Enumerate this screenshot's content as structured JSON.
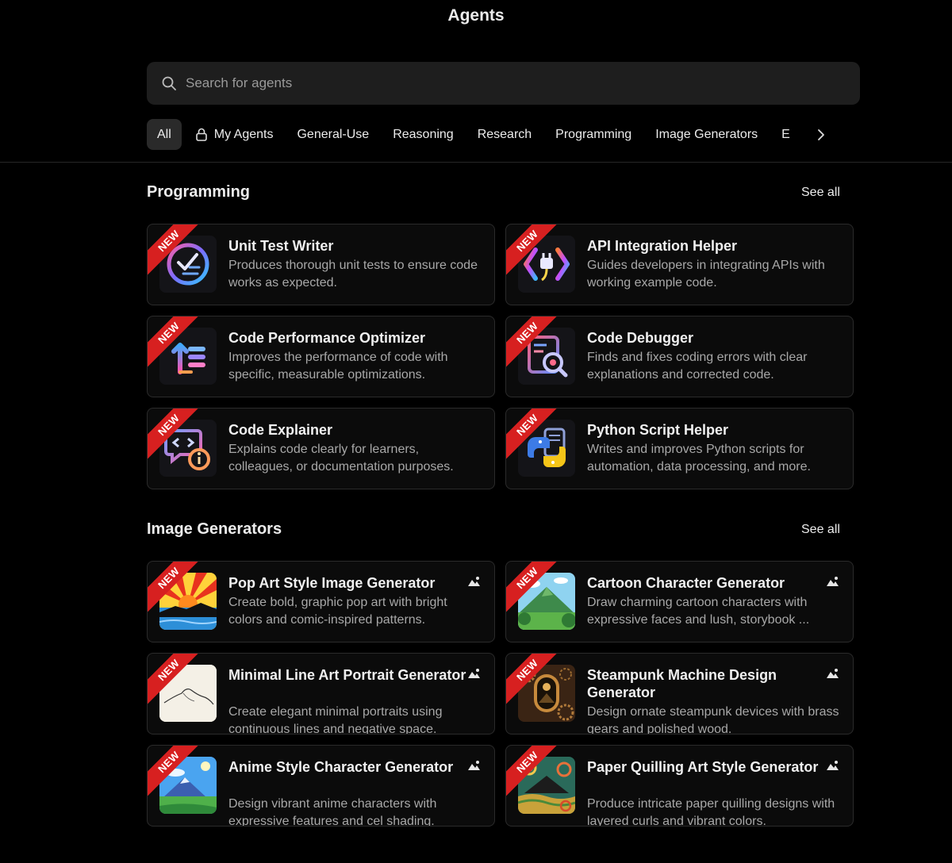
{
  "page": {
    "title": "Agents"
  },
  "search": {
    "placeholder": "Search for agents",
    "icon": "search-icon"
  },
  "tabs": [
    {
      "label": "All",
      "active": true
    },
    {
      "label": "My Agents",
      "icon": "lock-icon"
    },
    {
      "label": "General-Use"
    },
    {
      "label": "Reasoning"
    },
    {
      "label": "Research"
    },
    {
      "label": "Programming"
    },
    {
      "label": "Image Generators"
    },
    {
      "label": "E"
    }
  ],
  "sections": [
    {
      "title": "Programming",
      "see_all": "See all",
      "cards": [
        {
          "badge": "NEW",
          "name": "Unit Test Writer",
          "description": "Produces thorough unit tests to ensure code works as expected.",
          "icon": "checklist-icon"
        },
        {
          "badge": "NEW",
          "name": "API Integration Helper",
          "description": "Guides developers in integrating APIs with working example code.",
          "icon": "plug-icon"
        },
        {
          "badge": "NEW",
          "name": "Code Performance Optimizer",
          "description": "Improves the performance of code with specific, measurable optimizations.",
          "icon": "optimize-icon"
        },
        {
          "badge": "NEW",
          "name": "Code Debugger",
          "description": "Finds and fixes coding errors with clear explanations and corrected code.",
          "icon": "debug-icon"
        },
        {
          "badge": "NEW",
          "name": "Code Explainer",
          "description": "Explains code clearly for learners, colleagues, or documentation purposes.",
          "icon": "code-info-icon"
        },
        {
          "badge": "NEW",
          "name": "Python Script Helper",
          "description": "Writes and improves Python scripts for automation, data processing, and more.",
          "icon": "python-icon"
        }
      ]
    },
    {
      "title": "Image Generators",
      "see_all": "See all",
      "cards": [
        {
          "badge": "NEW",
          "name": "Pop Art Style Image Generator",
          "description": "Create bold, graphic pop art with bright colors and comic-inspired patterns.",
          "icon": "pop-art-image"
        },
        {
          "badge": "NEW",
          "name": "Cartoon Character Generator",
          "description": "Draw charming cartoon characters with expressive faces and lush, storybook ...",
          "icon": "cartoon-landscape-image"
        },
        {
          "badge": "NEW",
          "name": "Minimal Line Art Portrait Generator",
          "description": "Create elegant minimal portraits using continuous lines and negative space.",
          "icon": "line-art-image"
        },
        {
          "badge": "NEW",
          "name": "Steampunk Machine Design Generator",
          "description": "Design ornate steampunk devices with brass gears and polished wood.",
          "icon": "steampunk-image"
        },
        {
          "badge": "NEW",
          "name": "Anime Style Character Generator",
          "description": "Design vibrant anime characters with expressive features and cel shading.",
          "icon": "anime-landscape-image"
        },
        {
          "badge": "NEW",
          "name": "Paper Quilling Art Style Generator",
          "description": "Produce intricate paper quilling designs with layered curls and vibrant colors.",
          "icon": "quilling-image"
        }
      ]
    }
  ],
  "colors": {
    "background": "#000000",
    "card_border": "#2b2b2b",
    "badge": "#d72020",
    "muted_text": "#a8a8a8"
  }
}
